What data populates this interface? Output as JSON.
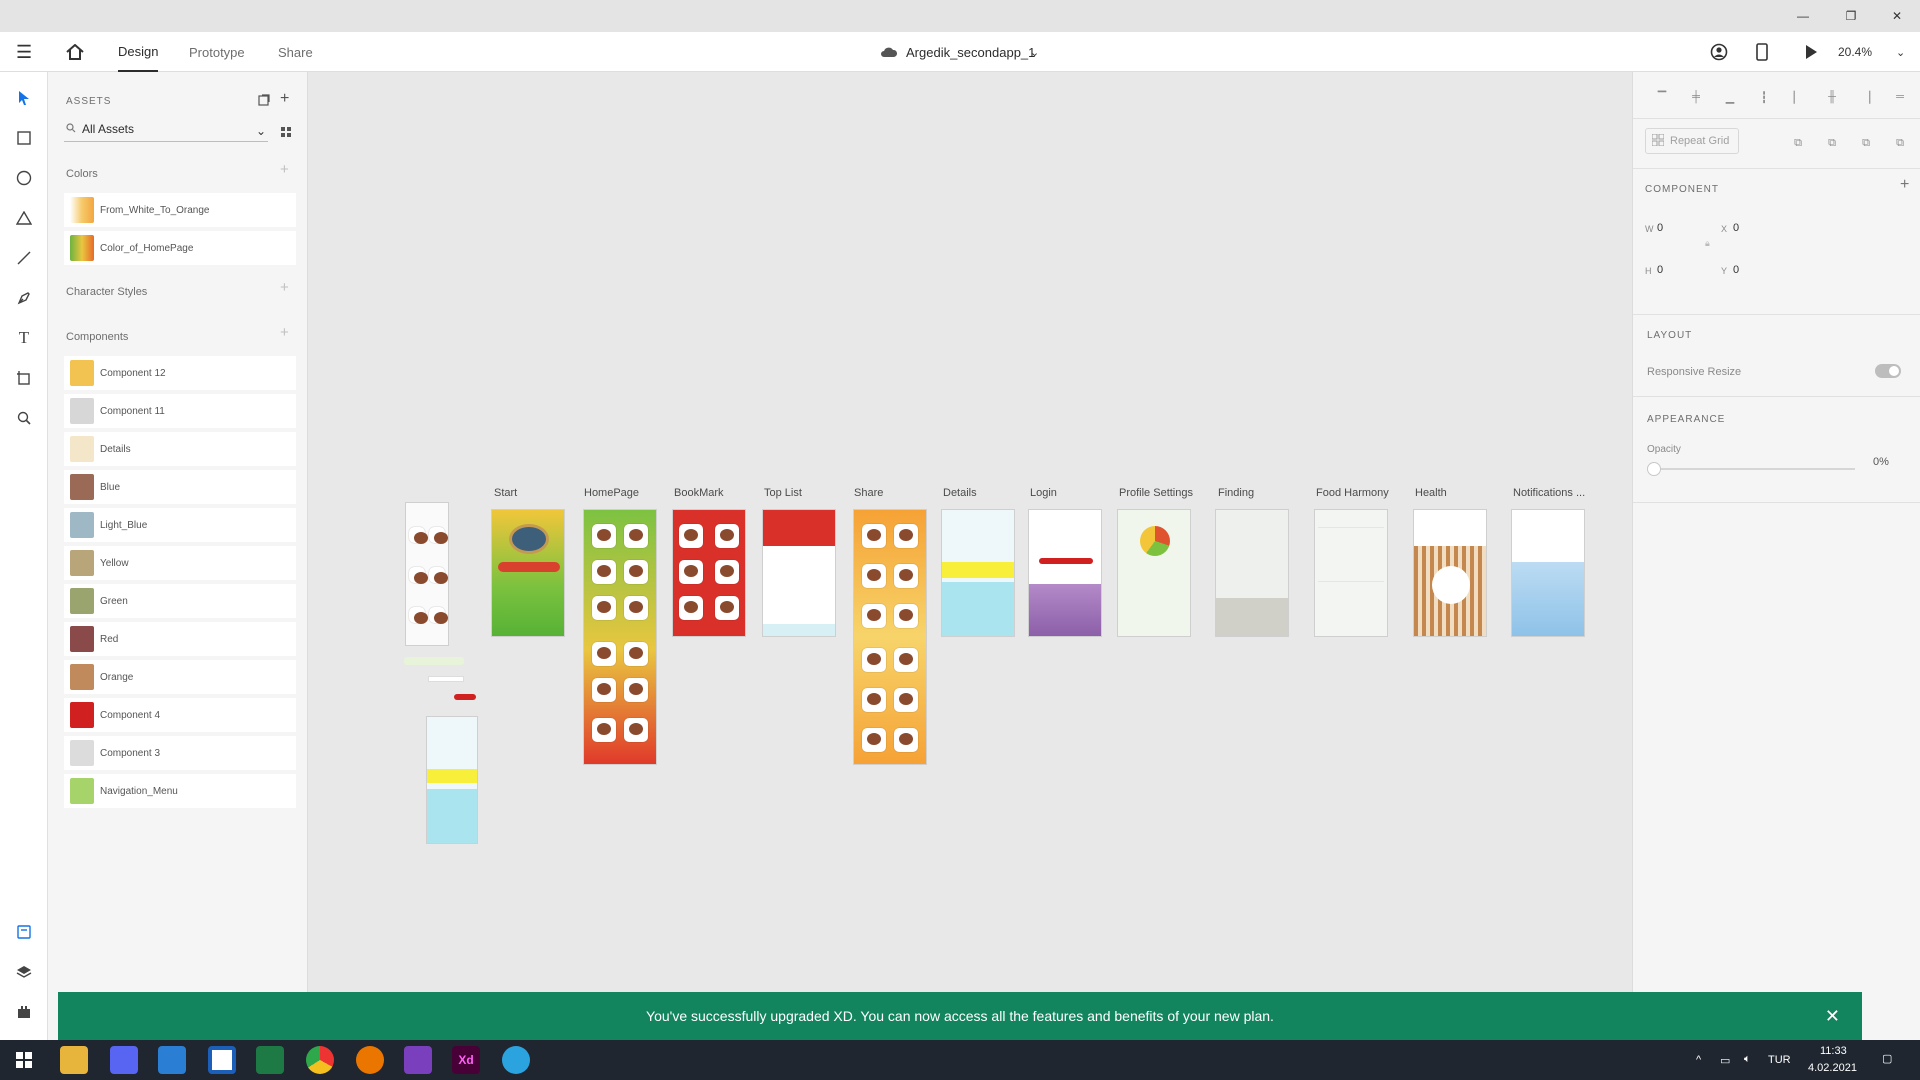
{
  "window": {
    "minimize": "—",
    "restore": "❐",
    "close": "✕"
  },
  "appbar": {
    "tabs": [
      "Design",
      "Prototype",
      "Share"
    ],
    "doc_title": "Argedik_secondapp_1",
    "zoom": "20.4%"
  },
  "assets": {
    "header": "ASSETS",
    "search_value": "All Assets",
    "colors_title": "Colors",
    "colors": [
      {
        "name": "From_White_To_Orange",
        "swatch": "#f6c96a"
      },
      {
        "name": "Color_of_HomePage",
        "swatch": "#e9c640"
      }
    ],
    "char_styles_title": "Character Styles",
    "components_title": "Components",
    "components": [
      {
        "name": "Component 12",
        "swatch": "#f2c350"
      },
      {
        "name": "Component 11",
        "swatch": "#d7d7d7"
      },
      {
        "name": "Details",
        "swatch": "#f4e6c8"
      },
      {
        "name": "Blue",
        "swatch": "#9a6a56"
      },
      {
        "name": "Light_Blue",
        "swatch": "#9fb8c6"
      },
      {
        "name": "Yellow",
        "swatch": "#b8a67a"
      },
      {
        "name": "Green",
        "swatch": "#9aa46e"
      },
      {
        "name": "Red",
        "swatch": "#8b4a4a"
      },
      {
        "name": "Orange",
        "swatch": "#c08a5c"
      },
      {
        "name": "Component 4",
        "swatch": "#d02020"
      },
      {
        "name": "Component 3",
        "swatch": "#dcdcdc"
      },
      {
        "name": "Navigation_Menu",
        "swatch": "#a7d46a"
      }
    ]
  },
  "artboards": [
    {
      "label": "Start"
    },
    {
      "label": "HomePage"
    },
    {
      "label": "BookMark"
    },
    {
      "label": "Top List"
    },
    {
      "label": "Share"
    },
    {
      "label": "Details"
    },
    {
      "label": "Login"
    },
    {
      "label": "Profile Settings"
    },
    {
      "label": "Finding"
    },
    {
      "label": "Food Harmony"
    },
    {
      "label": "Health"
    },
    {
      "label": "Notifications ..."
    }
  ],
  "props": {
    "repeat_grid": "Repeat Grid",
    "component": "COMPONENT",
    "w_label": "W",
    "w_value": "0",
    "x_label": "X",
    "x_value": "0",
    "h_label": "H",
    "h_value": "0",
    "y_label": "Y",
    "y_value": "0",
    "layout": "LAYOUT",
    "responsive": "Responsive Resize",
    "appearance": "APPEARANCE",
    "opacity_label": "Opacity",
    "opacity_value": "0%"
  },
  "notice": {
    "text": "You've successfully upgraded XD. You can now access all the features and benefits of your new plan."
  },
  "taskbar": {
    "lang": "TUR",
    "time": "11:33",
    "date": "4.02.2021"
  }
}
